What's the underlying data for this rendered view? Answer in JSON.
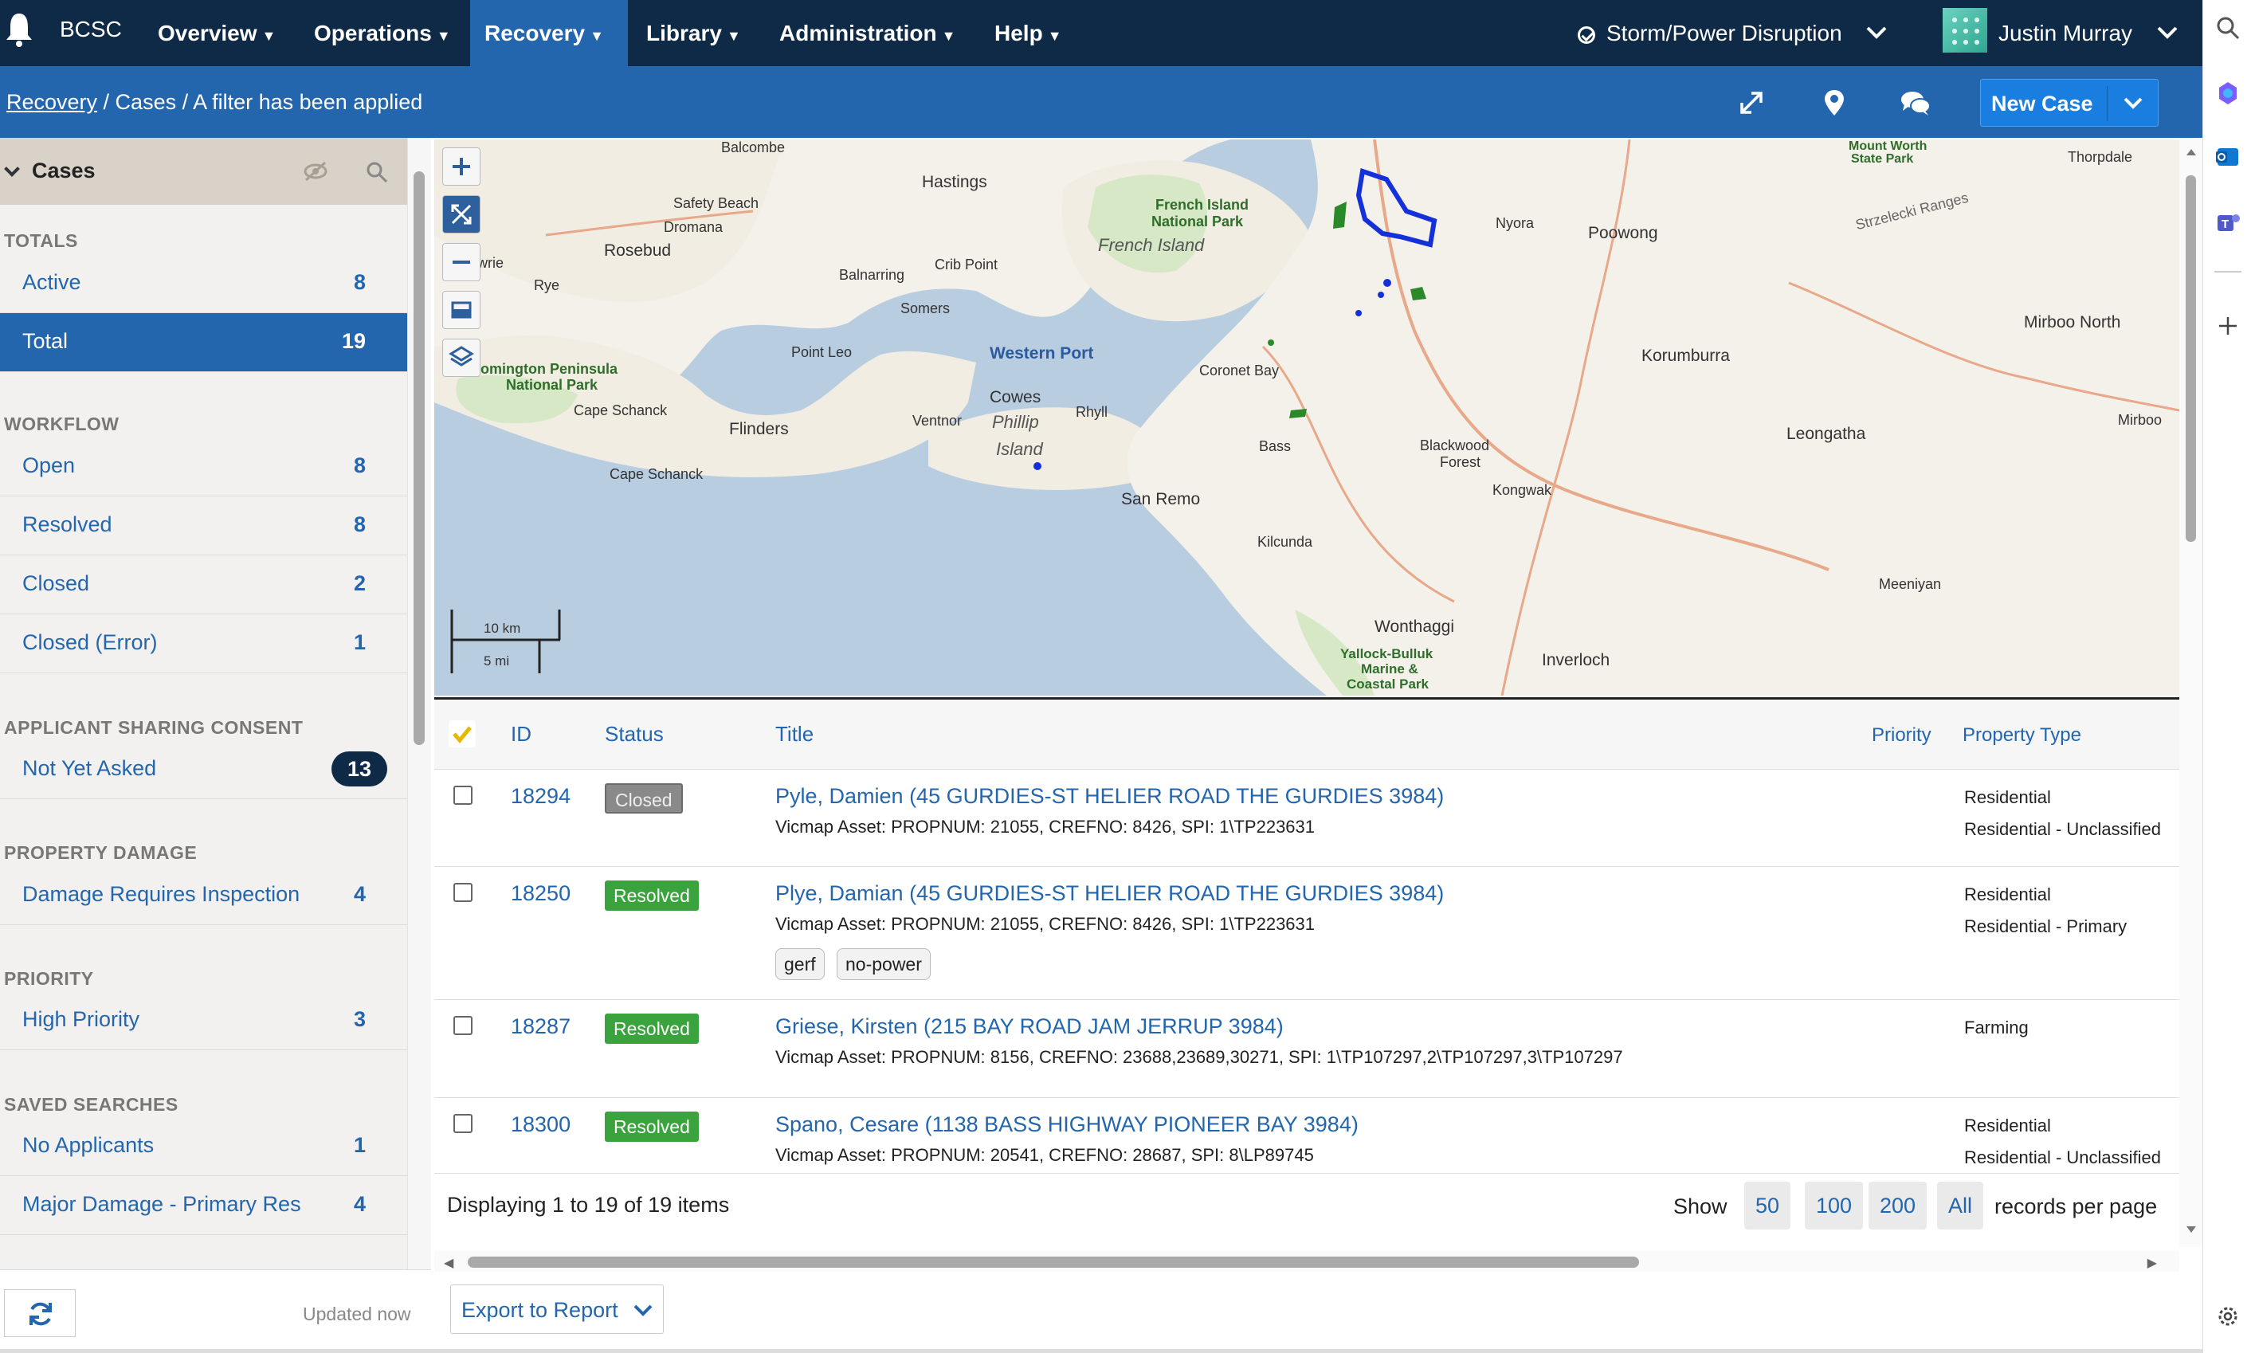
{
  "app": {
    "brand": "BCSC"
  },
  "nav": {
    "items": [
      {
        "label": "Overview"
      },
      {
        "label": "Operations"
      },
      {
        "label": "Recovery"
      },
      {
        "label": "Library"
      },
      {
        "label": "Administration"
      },
      {
        "label": "Help"
      }
    ],
    "active": "Recovery",
    "event": "Storm/Power Disruption",
    "user": "Justin Murray"
  },
  "breadcrumb": {
    "root": "Recovery",
    "rest": " / Cases / A filter has been applied"
  },
  "toolbar": {
    "new_case": "New Case"
  },
  "sidebar": {
    "title": "Cases",
    "sections": {
      "totals": "TOTALS",
      "workflow": "WORKFLOW",
      "consent": "APPLICANT SHARING CONSENT",
      "damage": "PROPERTY DAMAGE",
      "priority": "PRIORITY",
      "saved": "SAVED SEARCHES"
    },
    "totals": [
      {
        "label": "Active",
        "count": "8"
      },
      {
        "label": "Total",
        "count": "19"
      }
    ],
    "workflow": [
      {
        "label": "Open",
        "count": "8"
      },
      {
        "label": "Resolved",
        "count": "8"
      },
      {
        "label": "Closed",
        "count": "2"
      },
      {
        "label": "Closed (Error)",
        "count": "1"
      }
    ],
    "consent": [
      {
        "label": "Not Yet Asked",
        "count": "13"
      }
    ],
    "damage": [
      {
        "label": "Damage Requires Inspection",
        "count": "4"
      }
    ],
    "priority": [
      {
        "label": "High Priority",
        "count": "3"
      }
    ],
    "saved": [
      {
        "label": "No Applicants",
        "count": "1"
      },
      {
        "label": "Major Damage - Primary Res",
        "count": "4"
      }
    ],
    "updated": "Updated now"
  },
  "map": {
    "labels": {
      "balcombe": "Balcombe",
      "hastings": "Hastings",
      "safety_beach": "Safety Beach",
      "dromana": "Dromana",
      "rosebud": "Rosebud",
      "rye": "Rye",
      "sorrento_frag": "wrie",
      "balnarring": "Balnarring",
      "crib_point": "Crib Point",
      "somers": "Somers",
      "point_leo": "Point Leo",
      "mornington_np": "omington Peninsula",
      "mornington_np2": "National Park",
      "cape_schanck": "Cape Schanck",
      "cape_schanck2": "Cape Schanck",
      "flinders": "Flinders",
      "western_port": "Western Port",
      "french_np": "French Island",
      "french_np2": "National Park",
      "french_island": "French Island",
      "cowes": "Cowes",
      "ventnor": "Ventnor",
      "phillip": "Phillip",
      "island": "Island",
      "rhyll": "Rhyll",
      "coronet_bay": "Coronet Bay",
      "bass": "Bass",
      "san_remo": "San Remo",
      "kilcunda": "Kilcunda",
      "nyora": "Nyora",
      "poowong": "Poowong",
      "strzelecki": "Strzelecki Ranges",
      "mount_worth": "Mount Worth",
      "state_park": "State Park",
      "thorpdale": "Thorpdale",
      "korumburra": "Korumburra",
      "mirboo_north": "Mirboo North",
      "mirboo": "Mirboo",
      "leongatha": "Leongatha",
      "blackwood": "Blackwood",
      "forest": "Forest",
      "kongwak": "Kongwak",
      "meeniyan": "Meeniyan",
      "wonthaggi": "Wonthaggi",
      "inverloch": "Inverloch",
      "yallock": "Yallock-Bulluk",
      "marine": "Marine &",
      "coastal": "Coastal Park"
    },
    "scale_km": "10 km",
    "scale_mi": "5 mi"
  },
  "grid": {
    "headers": {
      "id": "ID",
      "status": "Status",
      "title": "Title",
      "priority": "Priority",
      "property_type": "Property Type"
    },
    "rows": [
      {
        "id": "18294",
        "status": "Closed",
        "title": "Pyle, Damien (45 GURDIES-ST HELIER ROAD THE GURDIES 3984)",
        "sub": "Vicmap Asset: PROPNUM: 21055, CREFNO: 8426, SPI: 1\\TP223631",
        "prop1": "Residential",
        "prop2": "Residential - Unclassified"
      },
      {
        "id": "18250",
        "status": "Resolved",
        "title": "Plye, Damian (45 GURDIES-ST HELIER ROAD THE GURDIES 3984)",
        "sub": "Vicmap Asset: PROPNUM: 21055, CREFNO: 8426, SPI: 1\\TP223631",
        "tags": [
          "gerf",
          "no-power"
        ],
        "prop1": "Residential",
        "prop2": "Residential - Primary"
      },
      {
        "id": "18287",
        "status": "Resolved",
        "title": "Griese, Kirsten (215 BAY ROAD JAM JERRUP 3984)",
        "sub": "Vicmap Asset: PROPNUM: 8156, CREFNO: 23688,23689,30271, SPI: 1\\TP107297,2\\TP107297,3\\TP107297",
        "prop1": "Farming",
        "prop2": ""
      },
      {
        "id": "18300",
        "status": "Resolved",
        "title": "Spano, Cesare (1138 BASS HIGHWAY PIONEER BAY 3984)",
        "sub": "Vicmap Asset: PROPNUM: 20541, CREFNO: 28687, SPI: 8\\LP89745",
        "prop1": "Residential",
        "prop2": "Residential - Unclassified"
      }
    ],
    "display": "Displaying 1 to 19 of 19 items",
    "show": "Show",
    "page_sizes": [
      "50",
      "100",
      "200",
      "All"
    ],
    "rpp": "records per page",
    "export": "Export to Report"
  }
}
